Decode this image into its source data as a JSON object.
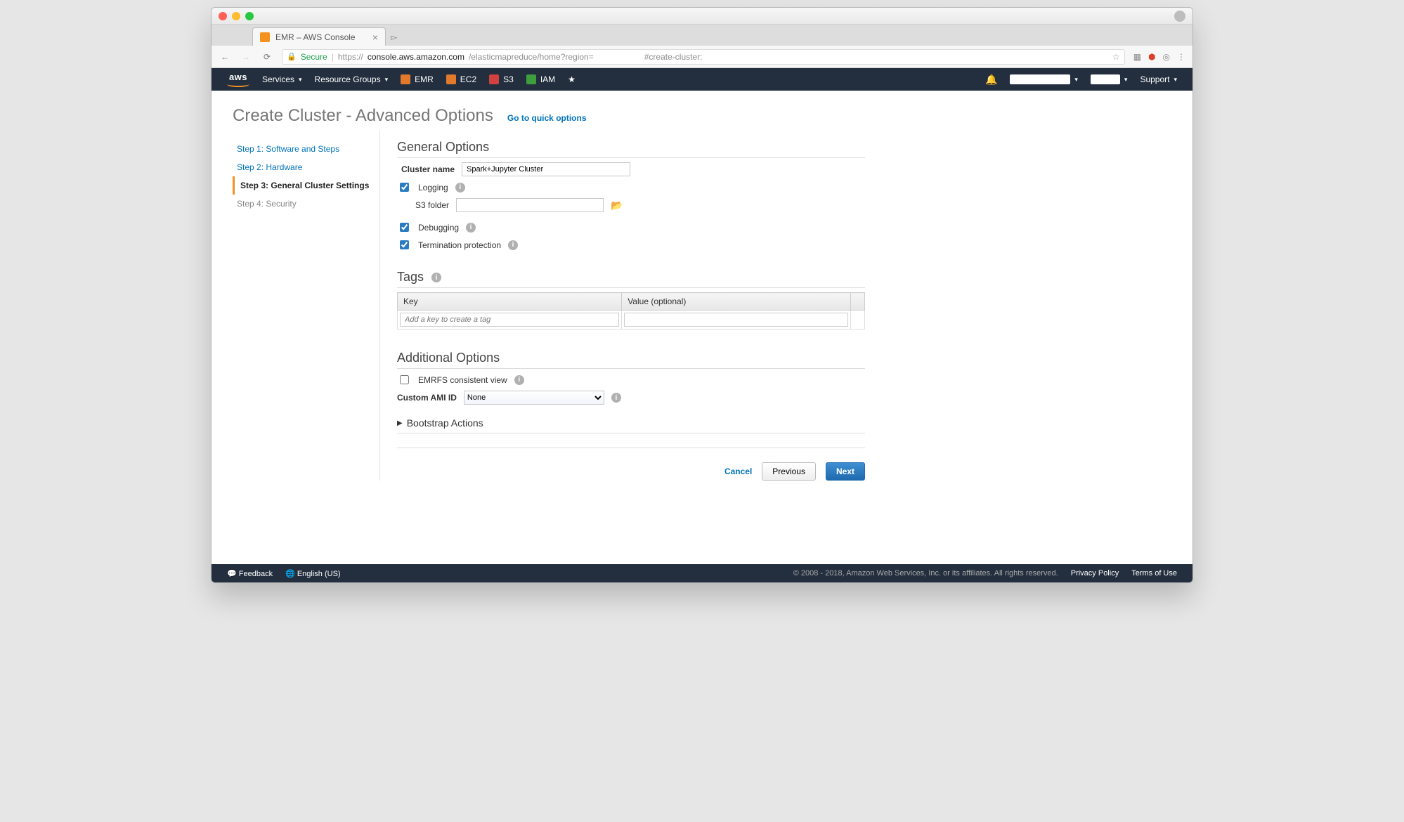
{
  "browser": {
    "tab_title": "EMR – AWS Console",
    "secure_label": "Secure",
    "url_prefix": "https://",
    "url_host": "console.aws.amazon.com",
    "url_path": "/elasticmapreduce/home?region=",
    "url_hash": "#create-cluster:"
  },
  "nav": {
    "services": "Services",
    "resource_groups": "Resource Groups",
    "svc": [
      "EMR",
      "EC2",
      "S3",
      "IAM"
    ],
    "support": "Support"
  },
  "header": {
    "title": "Create Cluster - Advanced Options",
    "quick_link": "Go to quick options"
  },
  "steps": [
    "Step 1: Software and Steps",
    "Step 2: Hardware",
    "Step 3: General Cluster Settings",
    "Step 4: Security"
  ],
  "general": {
    "heading": "General Options",
    "cluster_name_label": "Cluster name",
    "cluster_name_value": "Spark+Jupyter Cluster",
    "logging_label": "Logging",
    "logging_checked": true,
    "s3_folder_label": "S3 folder",
    "s3_folder_value": "",
    "debugging_label": "Debugging",
    "debugging_checked": true,
    "termination_label": "Termination protection",
    "termination_checked": true
  },
  "tags": {
    "heading": "Tags",
    "key_header": "Key",
    "value_header": "Value (optional)",
    "key_placeholder": "Add a key to create a tag"
  },
  "additional": {
    "heading": "Additional Options",
    "emrfs_label": "EMRFS consistent view",
    "emrfs_checked": false,
    "ami_label": "Custom AMI ID",
    "ami_value": "None",
    "bootstrap_heading": "Bootstrap Actions"
  },
  "buttons": {
    "cancel": "Cancel",
    "previous": "Previous",
    "next": "Next"
  },
  "footer": {
    "feedback": "Feedback",
    "language": "English (US)",
    "copyright": "© 2008 - 2018, Amazon Web Services, Inc. or its affiliates. All rights reserved.",
    "privacy": "Privacy Policy",
    "terms": "Terms of Use"
  }
}
